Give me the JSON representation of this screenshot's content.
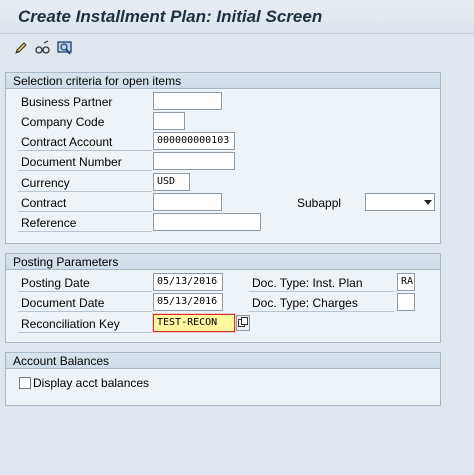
{
  "title": "Create Installment Plan: Initial Screen",
  "toolbar": {
    "icons": [
      "pencil-icon",
      "glasses-icon",
      "display-icon"
    ]
  },
  "selection": {
    "header": "Selection criteria for open items",
    "business_partner": {
      "label": "Business Partner",
      "value": ""
    },
    "company_code": {
      "label": "Company Code",
      "value": ""
    },
    "contract_account": {
      "label": "Contract Account",
      "value": "000000000103"
    },
    "document_number": {
      "label": "Document Number",
      "value": ""
    },
    "currency": {
      "label": "Currency",
      "value": "USD"
    },
    "contract": {
      "label": "Contract",
      "value": ""
    },
    "subappl": {
      "label": "Subappl",
      "value": ""
    },
    "reference": {
      "label": "Reference",
      "value": ""
    }
  },
  "posting": {
    "header": "Posting Parameters",
    "posting_date": {
      "label": "Posting Date",
      "value": "05/13/2016"
    },
    "document_date": {
      "label": "Document Date",
      "value": "05/13/2016"
    },
    "reconciliation_key": {
      "label": "Reconciliation Key",
      "value": "TEST-RECON"
    },
    "doc_type_inst_plan": {
      "label": "Doc. Type: Inst. Plan",
      "value": "RA"
    },
    "doc_type_charges": {
      "label": "Doc. Type: Charges",
      "value": ""
    }
  },
  "balances": {
    "header": "Account Balances",
    "display_acct_balances": {
      "label": "Display acct balances",
      "checked": false
    }
  },
  "colors": {
    "background": "#dfe6ee",
    "group_background": "#eef3f8",
    "focus_field": "#fff7a0",
    "focus_border": "#d03030"
  }
}
